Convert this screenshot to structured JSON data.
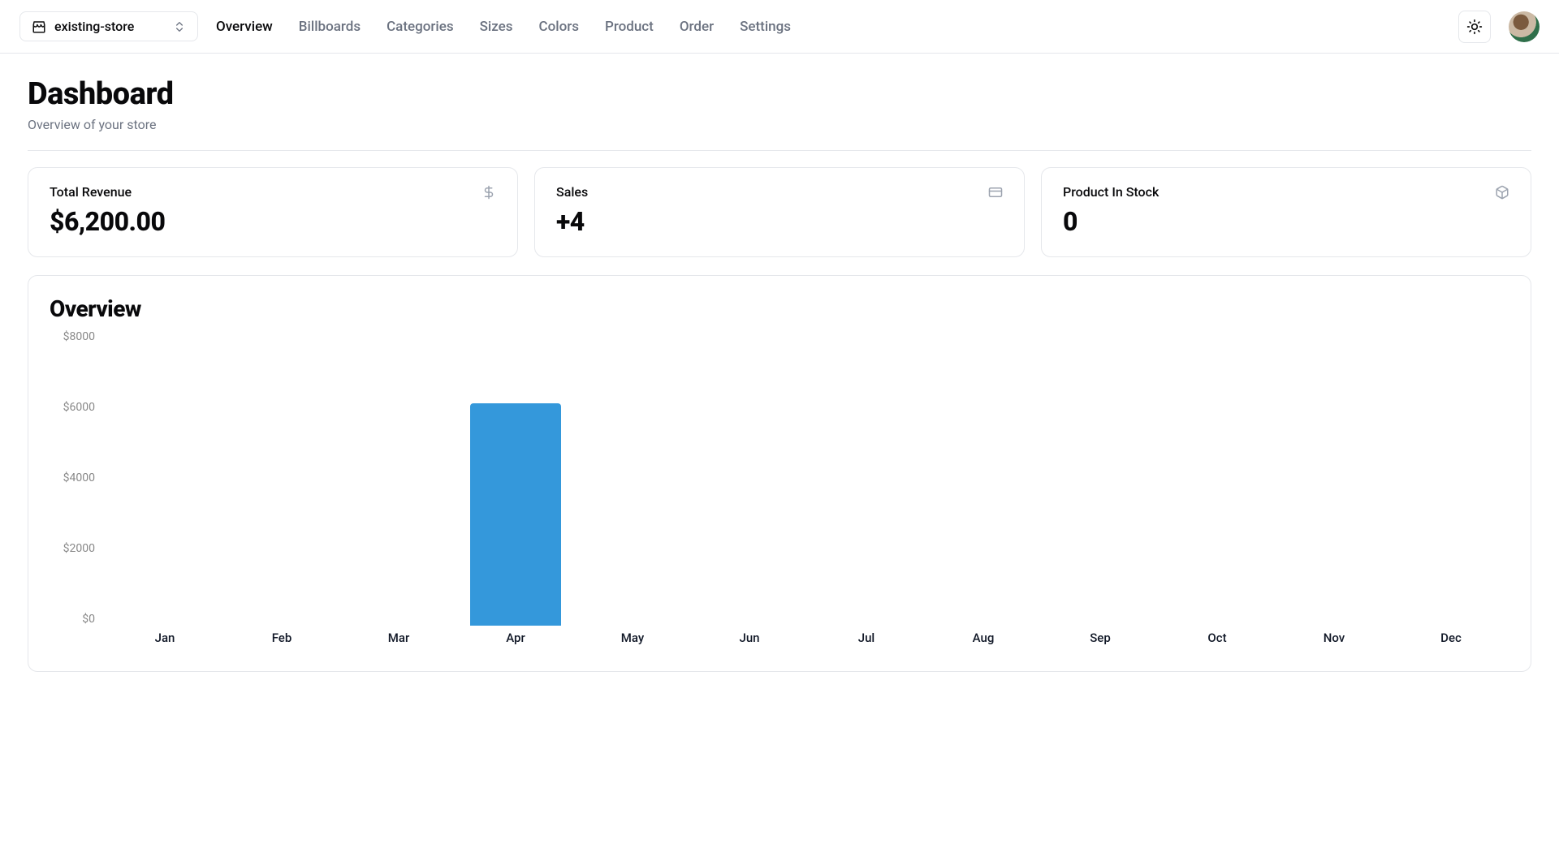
{
  "store_selector": {
    "selected": "existing-store"
  },
  "nav": {
    "items": [
      {
        "label": "Overview",
        "active": true
      },
      {
        "label": "Billboards",
        "active": false
      },
      {
        "label": "Categories",
        "active": false
      },
      {
        "label": "Sizes",
        "active": false
      },
      {
        "label": "Colors",
        "active": false
      },
      {
        "label": "Product",
        "active": false
      },
      {
        "label": "Order",
        "active": false
      },
      {
        "label": "Settings",
        "active": false
      }
    ]
  },
  "page": {
    "title": "Dashboard",
    "subtitle": "Overview of your store"
  },
  "stats": {
    "revenue": {
      "label": "Total Revenue",
      "value": "$6,200.00"
    },
    "sales": {
      "label": "Sales",
      "value": "+4"
    },
    "stock": {
      "label": "Product In Stock",
      "value": "0"
    }
  },
  "chart_title": "Overview",
  "chart_data": {
    "type": "bar",
    "categories": [
      "Jan",
      "Feb",
      "Mar",
      "Apr",
      "May",
      "Jun",
      "Jul",
      "Aug",
      "Sep",
      "Oct",
      "Nov",
      "Dec"
    ],
    "values": [
      0,
      0,
      0,
      6200,
      0,
      0,
      0,
      0,
      0,
      0,
      0,
      0
    ],
    "y_ticks": [
      "$8000",
      "$6000",
      "$4000",
      "$2000",
      "$0"
    ],
    "ylim": [
      0,
      8000
    ],
    "bar_color": "#3498db",
    "title": "Overview",
    "xlabel": "",
    "ylabel": ""
  }
}
